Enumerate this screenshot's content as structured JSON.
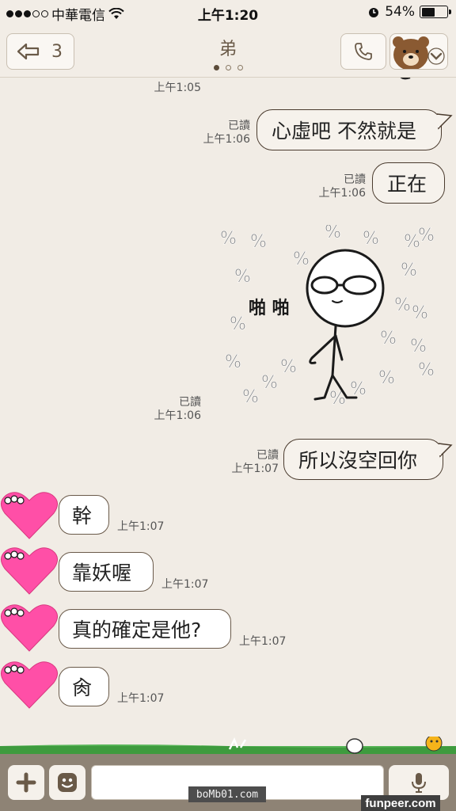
{
  "status": {
    "carrier": "中華電信",
    "time": "上午1:20",
    "battery": "54%",
    "battery_level": 0.54
  },
  "header": {
    "back_count": "3",
    "title": "弟"
  },
  "messages": [
    {
      "dir": "out",
      "time": "上午1:05"
    },
    {
      "dir": "out",
      "read": "已讀",
      "time": "上午1:06",
      "text": "心虛吧 不然就是"
    },
    {
      "dir": "out",
      "read": "已讀",
      "time": "上午1:06",
      "text": "正在"
    },
    {
      "dir": "out",
      "read": "已讀",
      "time": "上午1:06",
      "sticker_text": "啪 啪"
    },
    {
      "dir": "out",
      "read": "已讀",
      "time": "上午1:07",
      "text": "所以沒空回你"
    },
    {
      "dir": "in",
      "time": "上午1:07",
      "text": "幹"
    },
    {
      "dir": "in",
      "time": "上午1:07",
      "text": "靠妖喔"
    },
    {
      "dir": "in",
      "time": "上午1:07",
      "text": "真的確定是他?"
    },
    {
      "dir": "in",
      "time": "上午1:07",
      "text": "肏"
    }
  ],
  "input": {
    "value": ""
  },
  "watermarks": {
    "left": "boMb01.com",
    "right": "funpeer.com"
  },
  "colors": {
    "bubble_out": "#f6f2ec",
    "bubble_in": "#ffffff",
    "heart": "#ff4fa7",
    "input_bar": "#8e8375"
  }
}
